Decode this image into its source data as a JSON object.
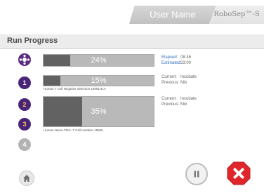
{
  "header": {
    "user_name": "User Name",
    "brand": "RoboSep™-S"
  },
  "title": "Run Progress",
  "colors": {
    "purple": "#4a2478",
    "yellow": "#f2c84b",
    "bar_fill": "#626262",
    "bar_bg": "#b9b9b9",
    "stop_red": "#e0262b",
    "label_blue": "#2f6fbf"
  },
  "steps": [
    {
      "icon": "all-quadrants-icon"
    },
    {
      "label": "1"
    },
    {
      "label": "2"
    },
    {
      "label": "3"
    },
    {
      "label": "4"
    }
  ],
  "overall": {
    "progress_label": "24%",
    "progress": 0.24,
    "elapsed_label": "Elapsed:",
    "elapsed": "08:46",
    "estimated_label": "Estimated:",
    "estimated": "33:00"
  },
  "protocols": [
    {
      "progress_label": "15%",
      "progress": 0.15,
      "name": "Human T Cell Negative Selection 19061HLA",
      "current_label": "Current:",
      "current": "Incubate",
      "previous_label": "Previous:",
      "previous": "Mix"
    },
    {
      "progress_label": "35%",
      "progress": 0.35,
      "name": "Human Naive CD4+ T Cell Isolation 19555",
      "current_label": "Current:",
      "current": "Incubate",
      "previous_label": "Previous:",
      "previous": "Mix"
    }
  ],
  "controls": {
    "home_icon": "home-icon",
    "pause_icon": "pause-icon",
    "stop_icon": "close-icon"
  }
}
